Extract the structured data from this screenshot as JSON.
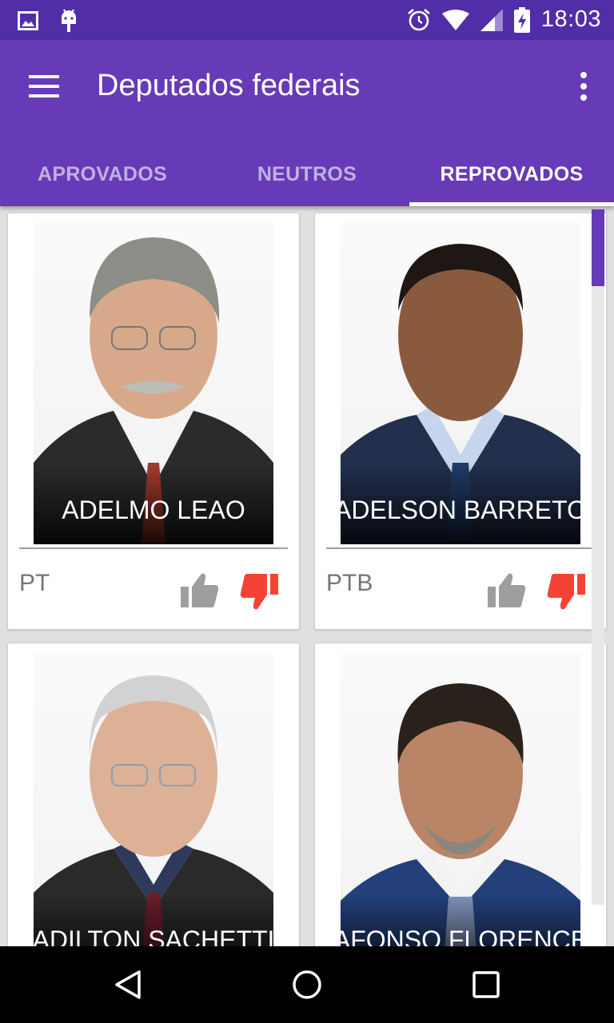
{
  "status_bar": {
    "time": "18:03"
  },
  "app_bar": {
    "title": "Deputados federais"
  },
  "tabs": [
    {
      "label": "APROVADOS",
      "active": false
    },
    {
      "label": "NEUTROS",
      "active": false
    },
    {
      "label": "REPROVADOS",
      "active": true
    }
  ],
  "deputies": [
    {
      "name": "ADELMO LEAO",
      "party": "PT"
    },
    {
      "name": "ADELSON BARRETO",
      "party": "PTB"
    },
    {
      "name": "ADILTON SACHETTI",
      "party": ""
    },
    {
      "name": "AFONSO FLORENCE",
      "party": ""
    }
  ],
  "colors": {
    "primary": "#673ab7",
    "primary_dark": "#512da8",
    "dislike": "#f44336",
    "like": "#9e9e9e"
  }
}
